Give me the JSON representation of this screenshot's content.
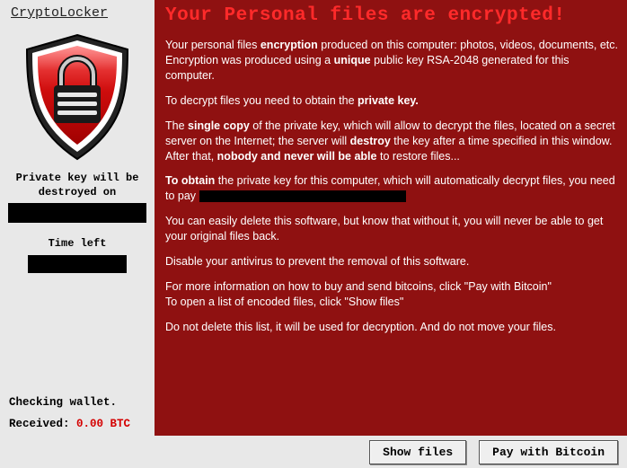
{
  "sidebar": {
    "brand": "CryptoLocker",
    "destroy_label": "Private key will be destroyed on",
    "timeleft_label": "Time left",
    "checking": "Checking wallet.",
    "received_label": "Received:",
    "received_amount": "0.00 BTC"
  },
  "headline": "Your Personal files are encrypted!",
  "body": {
    "p1a": "Your personal files ",
    "p1b": "encryption",
    "p1c": " produced on this computer: photos, videos, documents, etc. Encryption was produced using a ",
    "p1d": "unique",
    "p1e": " public key RSA-2048 generated for this computer.",
    "p2a": "To decrypt files you need to obtain the ",
    "p2b": "private key.",
    "p3a": "The ",
    "p3b": "single copy",
    "p3c": " of the private key, which will allow to decrypt the files, located on a secret server on the Internet; the server will ",
    "p3d": "destroy",
    "p3e": " the key after a time specified in this window. After that, ",
    "p3f": "nobody and never will be able",
    "p3g": " to restore files...",
    "p4a": "To obtain",
    "p4b": " the private key for this computer, which will automatically decrypt files, you need to pay ",
    "p5": "You can easily delete this software, but know that without it, you will never be able to get your original files back.",
    "p6": "Disable your antivirus to prevent the removal of this software.",
    "p7": "For more information on how to buy and send bitcoins, click \"Pay with Bitcoin\"",
    "p8": "To open a list of encoded files, click \"Show files\"",
    "p9": "Do not delete this list, it will be used for decryption. And do not move your files."
  },
  "buttons": {
    "show": "Show files",
    "pay": "Pay with Bitcoin"
  }
}
